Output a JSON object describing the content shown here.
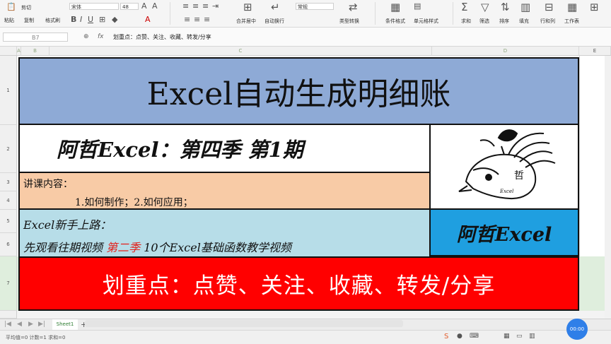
{
  "ribbon": {
    "row1": [
      "剪切",
      "宋体",
      "48",
      "常规"
    ],
    "row2": [
      "粘贴",
      "复制",
      "格式刷",
      "合并居中",
      "自动换行",
      "类型转换",
      "条件格式",
      "单元格样式",
      "求和",
      "筛选",
      "排序",
      "填充",
      "行和列",
      "工作表"
    ]
  },
  "formula_bar": {
    "cell_ref": "B7",
    "fx": "fx",
    "content": "划重点：点赞、关注、收藏、转发/分享"
  },
  "columns": [
    "A",
    "B",
    "C",
    "D",
    "E"
  ],
  "rows": [
    "1",
    "2",
    "3",
    "4",
    "5",
    "6",
    "7"
  ],
  "sheet": {
    "title": "Excel自动生成明细账",
    "subtitle": "阿哲Excel：第四季 第1期",
    "lesson_label": "讲课内容：",
    "lesson_items": "1.如何制作；2.如何应用；",
    "newbie": "Excel新手上路：",
    "watch_prefix": "先观看往期视频",
    "watch_season": "第二季",
    "watch_suffix": "10个Excel基础函数教学视频",
    "brand": "阿哲Excel",
    "banner": "划重点：点赞、关注、收藏、转发/分享",
    "logo_text": "Excel"
  },
  "tabs": {
    "sheet_tab": "Sheet1",
    "add": "+"
  },
  "status": {
    "left": "平均值=0  计数=1  求和=0",
    "timer": "00:00"
  }
}
